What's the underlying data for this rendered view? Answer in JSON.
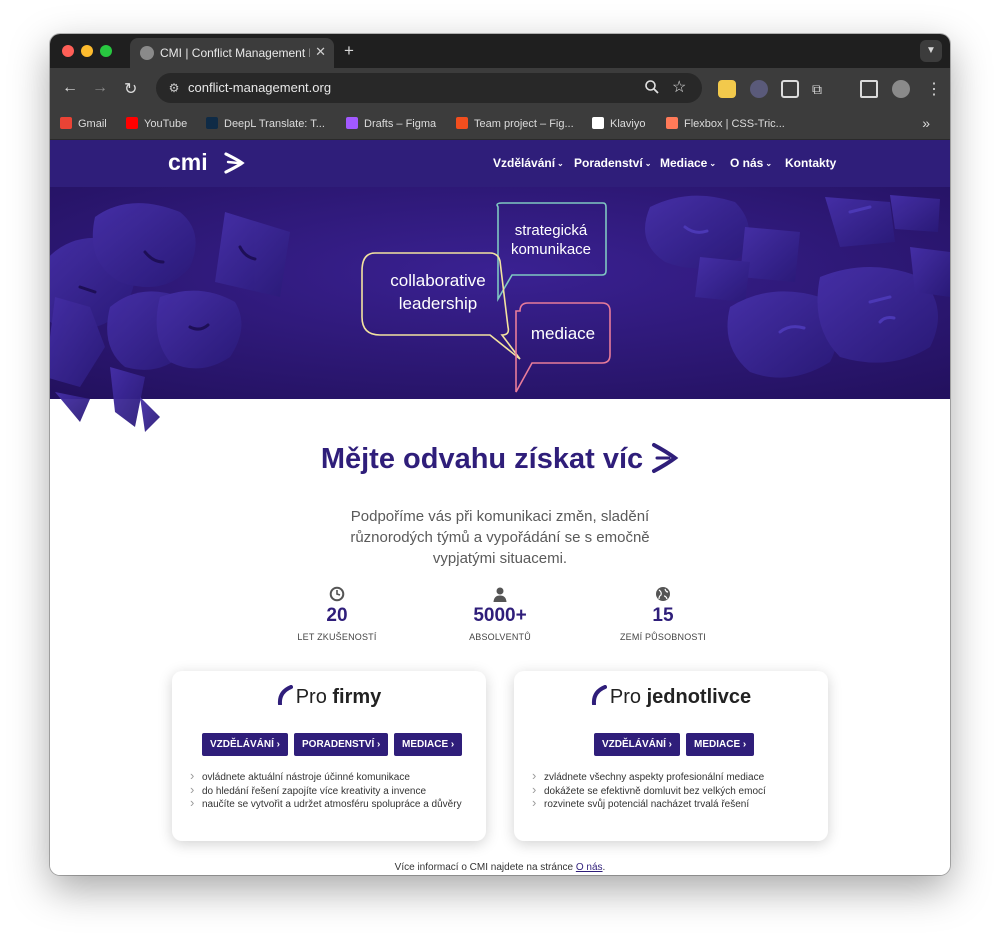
{
  "browser": {
    "tab_title": "CMI | Conflict Management In",
    "url": "conflict-management.org",
    "bookmarks": [
      {
        "label": "Gmail",
        "icon": "gmail-icon",
        "color": "#ea4335"
      },
      {
        "label": "YouTube",
        "icon": "youtube-icon",
        "color": "#ff0000"
      },
      {
        "label": "DeepL Translate: T...",
        "icon": "deepl-icon",
        "color": "#0f2b46"
      },
      {
        "label": "Drafts – Figma",
        "icon": "figma-icon",
        "color": "#a259ff"
      },
      {
        "label": "Team project – Fig...",
        "icon": "figma-icon",
        "color": "#f24e1e"
      },
      {
        "label": "Klaviyo",
        "icon": "klaviyo-icon",
        "color": "#ffffff"
      },
      {
        "label": "Flexbox | CSS-Tric...",
        "icon": "css-tricks-icon",
        "color": "#ff7a59"
      }
    ]
  },
  "site": {
    "logo_text": "cmi",
    "menu": [
      {
        "label": "Vzdělávání",
        "dropdown": true
      },
      {
        "label": "Poradenství",
        "dropdown": true
      },
      {
        "label": "Mediace",
        "dropdown": true
      },
      {
        "label": "O nás",
        "dropdown": true
      },
      {
        "label": "Kontakty",
        "dropdown": false
      }
    ],
    "hero_bubbles": {
      "top": [
        "strategická",
        "komunikace"
      ],
      "left": [
        "collaborative",
        "leadership"
      ],
      "right": [
        "mediace"
      ]
    },
    "headline": "Mějte odvahu získat víc",
    "lead": "Podpoříme vás při komunikaci změn, sladění různorodých týmů a vypořádání se s emočně vypjatými situacemi.",
    "stats": [
      {
        "icon": "clock-icon",
        "value": "20",
        "label": "LET ZKUŠENOSTÍ"
      },
      {
        "icon": "person-icon",
        "value": "5000+",
        "label": "ABSOLVENTŮ"
      },
      {
        "icon": "globe-icon",
        "value": "15",
        "label": "ZEMÍ PŮSOBNOSTI"
      }
    ],
    "cards": [
      {
        "title_prefix": "Pro",
        "title_bold": "firmy",
        "buttons": [
          "VZDĚLÁVÁNÍ",
          "PORADENSTVÍ",
          "MEDIACE"
        ],
        "bullets": [
          "ovládnete aktuální nástroje účinné komunikace",
          "do hledání řešení zapojíte více kreativity a invence",
          "naučíte se vytvořit a udržet atmosféru spolupráce a důvěry"
        ]
      },
      {
        "title_prefix": "Pro",
        "title_bold": "jednotlivce",
        "buttons": [
          "VZDĚLÁVÁNÍ",
          "MEDIACE"
        ],
        "bullets": [
          "zvládnete všechny aspekty profesionální mediace",
          "dokážete se efektivně domluvit bez velkých emocí",
          "rozvinete svůj potenciál nacházet trvalá řešení"
        ]
      }
    ],
    "footnote": {
      "text": "Více informací o CMI najdete na stránce",
      "link": "O nás",
      "suffix": "."
    },
    "colors": {
      "brand": "#2f1e7a",
      "hero_bg": "#2a1570",
      "bubble_yellow": "#f3e3a0",
      "bubble_teal": "#7fc7c2",
      "bubble_pink": "#e87c9a"
    }
  }
}
